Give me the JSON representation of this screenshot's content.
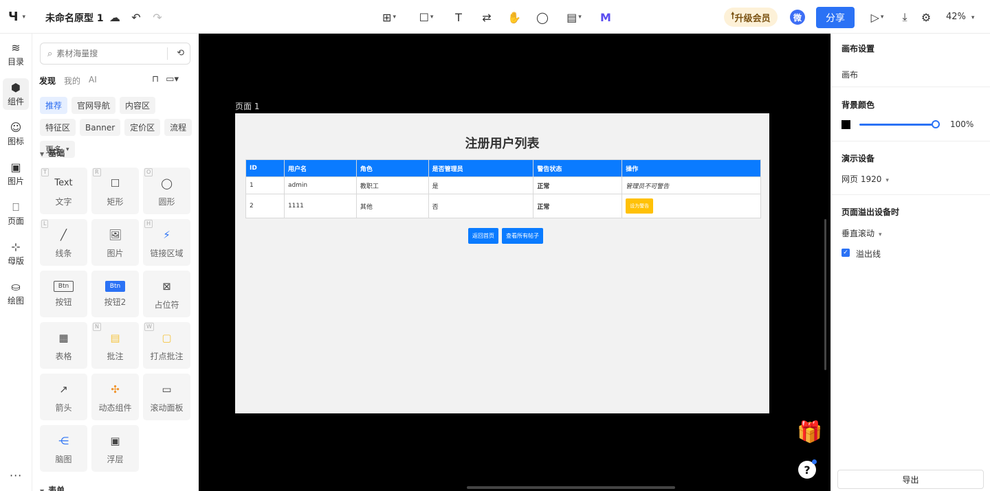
{
  "header": {
    "logo": "Ч",
    "title": "未命名原型 1",
    "upgrade": "升级会员",
    "avatar": "微",
    "share": "分享",
    "zoom": "42%"
  },
  "rail": {
    "items": [
      {
        "icon": "≋",
        "label": "目录"
      },
      {
        "icon": "⬢",
        "label": "组件"
      },
      {
        "icon": "☺",
        "label": "图标"
      },
      {
        "icon": "▣",
        "label": "图片"
      },
      {
        "icon": "⎕",
        "label": "页面"
      },
      {
        "icon": "⊹",
        "label": "母版"
      },
      {
        "icon": "⛀",
        "label": "绘图"
      }
    ],
    "more": "···"
  },
  "panel": {
    "search_placeholder": "素材海量搜",
    "tabs": [
      "发现",
      "我的",
      "AI"
    ],
    "chips": [
      "推荐",
      "官网导航",
      "内容区",
      "特征区",
      "Banner",
      "定价区",
      "流程",
      "更多"
    ],
    "section": "基础",
    "components": [
      {
        "key": "T",
        "glyph": "Text",
        "label": "文字"
      },
      {
        "key": "R",
        "glyph": "☐",
        "label": "矩形"
      },
      {
        "key": "O",
        "glyph": "◯",
        "label": "圆形"
      },
      {
        "key": "L",
        "glyph": "╱",
        "label": "线条"
      },
      {
        "key": "",
        "glyph": "🖼",
        "label": "图片"
      },
      {
        "key": "H",
        "glyph": "⚡",
        "label": "链接区域"
      },
      {
        "key": "",
        "glyph": "Btn",
        "label": "按钮"
      },
      {
        "key": "",
        "glyph": "Btn",
        "label": "按钮2"
      },
      {
        "key": "",
        "glyph": "⊠",
        "label": "占位符"
      },
      {
        "key": "",
        "glyph": "▦",
        "label": "表格"
      },
      {
        "key": "N",
        "glyph": "▤",
        "label": "批注"
      },
      {
        "key": "W",
        "glyph": "▢",
        "label": "打点批注"
      },
      {
        "key": "",
        "glyph": "↗",
        "label": "箭头"
      },
      {
        "key": "",
        "glyph": "✣",
        "label": "动态组件"
      },
      {
        "key": "",
        "glyph": "▭",
        "label": "滚动面板"
      },
      {
        "key": "",
        "glyph": "⋲",
        "label": "脑图"
      },
      {
        "key": "",
        "glyph": "▣",
        "label": "浮层"
      }
    ],
    "section2": "表单"
  },
  "canvas": {
    "page_label": "页面 1",
    "page_title": "注册用户列表",
    "table": {
      "headers": [
        "ID",
        "用户名",
        "角色",
        "是否管理员",
        "警告状态",
        "操作"
      ],
      "rows": [
        [
          "1",
          "admin",
          "教职工",
          "是",
          "正常",
          "管理员不可警告"
        ],
        [
          "2",
          "1111",
          "其他",
          "否",
          "正常",
          "设为警告"
        ]
      ]
    },
    "buttons": [
      "返回首页",
      "查看所有帖子"
    ],
    "help": "?"
  },
  "right": {
    "canvas_settings": "画布设置",
    "canvas": "画布",
    "bg_color": "背景颜色",
    "opacity": "100%",
    "device_title": "演示设备",
    "device": "网页 1920",
    "overflow_title": "页面溢出设备时",
    "overflow": "垂直滚动",
    "overflow_line": "溢出线",
    "export": "导出"
  },
  "colors": {
    "accent": "#2b72f5",
    "table_header": "#0a7bff",
    "ok": "#1d9b2c",
    "warn": "#ffc107"
  }
}
